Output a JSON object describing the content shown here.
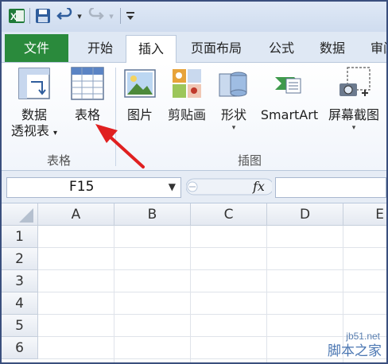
{
  "tabs": [
    "文件",
    "开始",
    "插入",
    "页面布局",
    "公式",
    "数据",
    "审阅"
  ],
  "active_tab": "插入",
  "ribbon": {
    "groups": [
      {
        "label": "表格",
        "buttons": [
          {
            "line1": "数据",
            "line2": "透视表"
          },
          {
            "line1": "表格"
          }
        ]
      },
      {
        "label": "插图",
        "buttons": [
          {
            "line1": "图片"
          },
          {
            "line1": "剪贴画"
          },
          {
            "line1": "形状"
          },
          {
            "line1": "SmartArt"
          },
          {
            "line1": "屏幕截图"
          }
        ]
      }
    ]
  },
  "formula_bar": {
    "name_box": "F15",
    "fx": "fx",
    "formula": ""
  },
  "grid": {
    "columns": [
      "A",
      "B",
      "C",
      "D",
      "E"
    ],
    "rows": [
      "1",
      "2",
      "3",
      "4",
      "5",
      "6"
    ]
  },
  "annotation": {
    "color": "#e02020"
  },
  "watermark": {
    "site": "jb51.net",
    "name": "脚本之家"
  },
  "colors": {
    "file_tab": "#2a8a3c",
    "ribbon_bg": "#f1f5fb"
  }
}
